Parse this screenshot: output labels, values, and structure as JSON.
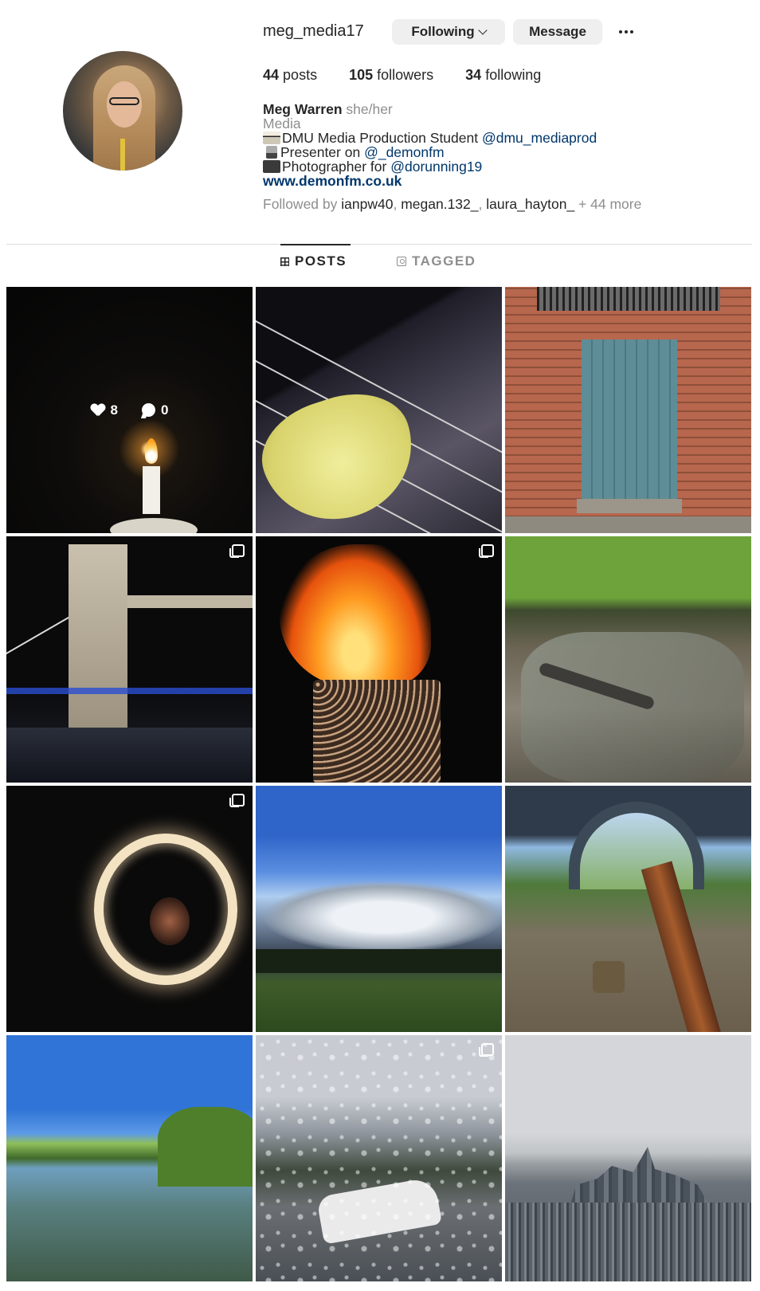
{
  "profile": {
    "username": "meg_media17",
    "following_button": "Following",
    "message_button": "Message",
    "stats": {
      "posts_count": "44",
      "posts_label": "posts",
      "followers_count": "105",
      "followers_label": "followers",
      "following_count": "34",
      "following_label": "following"
    },
    "bio": {
      "name": "Meg Warren",
      "pronouns": "she/her",
      "category": "Media",
      "line1_text": "DMU Media Production Student",
      "line1_mention": "@dmu_mediaprod",
      "line2_text": "Presenter on",
      "line2_mention": "@_demonfm",
      "line3_text": "Photographer for",
      "line3_mention": "@dorunning19",
      "website": "www.demonfm.co.uk"
    },
    "followed_by": {
      "prefix": "Followed by",
      "user1": "ianpw40",
      "user2": "megan.132_",
      "user3": "laura_hayton_",
      "more": "+ 44 more"
    }
  },
  "tabs": [
    {
      "label": "POSTS",
      "active": true
    },
    {
      "label": "TAGGED",
      "active": false
    }
  ],
  "posts": [
    {
      "subject": "candle in dark room",
      "multi": false,
      "likes": "8",
      "comments": "0",
      "hovered": true
    },
    {
      "subject": "guitar pick on strings",
      "multi": false
    },
    {
      "subject": "blue door in brick wall",
      "multi": false
    },
    {
      "subject": "Tower Bridge at night",
      "multi": true
    },
    {
      "subject": "fire in basket",
      "multi": true
    },
    {
      "subject": "stream with rocks",
      "multi": false
    },
    {
      "subject": "sparkler ring",
      "multi": true
    },
    {
      "subject": "sun rays through clouds",
      "multi": false
    },
    {
      "subject": "railway track under bridge",
      "multi": false
    },
    {
      "subject": "lake with trees",
      "multi": false
    },
    {
      "subject": "rain on window with car",
      "multi": true
    },
    {
      "subject": "city skyline from above",
      "multi": false
    }
  ]
}
